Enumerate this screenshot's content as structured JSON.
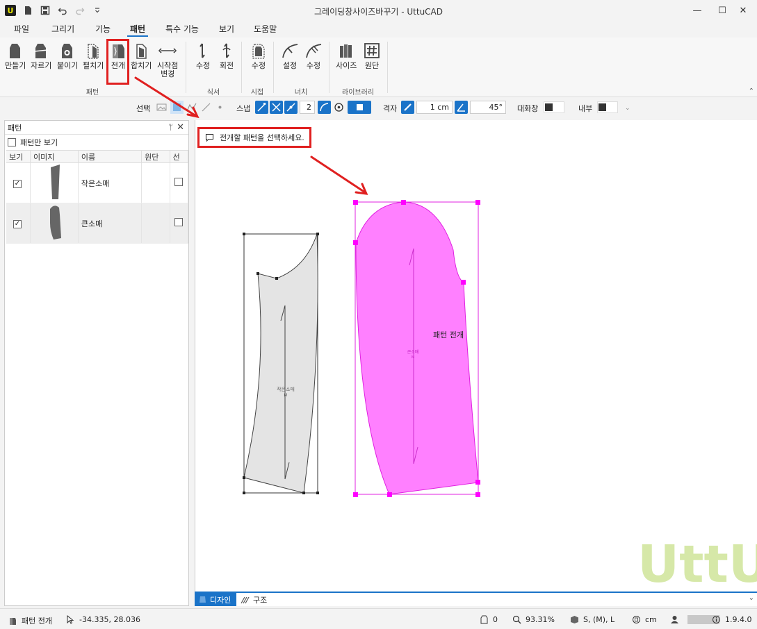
{
  "window": {
    "title": "그레이딩창사이즈바꾸기 - UttuCAD",
    "logo": "U",
    "minimize": "—",
    "maximize": "☐",
    "close": "✕"
  },
  "menu": {
    "tabs": [
      {
        "label": "파일"
      },
      {
        "label": "그리기"
      },
      {
        "label": "기능"
      },
      {
        "label": "패턴"
      },
      {
        "label": "특수 기능"
      },
      {
        "label": "보기"
      },
      {
        "label": "도움말"
      }
    ]
  },
  "ribbon": {
    "buttons": [
      {
        "label": "만들기"
      },
      {
        "label": "자르기"
      },
      {
        "label": "붙이기"
      },
      {
        "label": "펼치기"
      },
      {
        "label": "전개"
      },
      {
        "label": "합치기"
      },
      {
        "label": "시작점\n변경"
      },
      {
        "label": "수정"
      },
      {
        "label": "회전"
      },
      {
        "label": "수정"
      },
      {
        "label": "설정"
      },
      {
        "label": "수정"
      },
      {
        "label": "사이즈"
      },
      {
        "label": "원단"
      }
    ],
    "groups": [
      {
        "label": "패턴"
      },
      {
        "label": "식서"
      },
      {
        "label": "시접"
      },
      {
        "label": "너치"
      },
      {
        "label": "라이브러리"
      }
    ]
  },
  "toolbar2": {
    "select_label": "선택",
    "snap_label": "스냅",
    "snap_value": "2",
    "grid_label": "격자",
    "grid_value": "1 cm",
    "angle_value": "45°",
    "dialog_label": "대화창",
    "inner_label": "내부"
  },
  "panel": {
    "title": "패턴",
    "pin": "ᛘ",
    "close": "✕",
    "pattern_only_label": "패턴만 보기",
    "columns": [
      "보기",
      "이미지",
      "이름",
      "원단",
      "선"
    ],
    "rows": [
      {
        "visible": "✓",
        "name": "작은소매",
        "fabric": "",
        "line": ""
      },
      {
        "visible": "✓",
        "name": "큰소매",
        "fabric": "",
        "line": ""
      }
    ]
  },
  "canvas": {
    "prompt": "전개할 패턴을 선택하세요.",
    "pattern1_label": "작은소매",
    "pattern1_size": "M",
    "pattern2_label": "큰소매",
    "pattern2_size": "M",
    "annotation": "패턴 전개",
    "watermark": "UttU",
    "colors": {
      "selected_fill": "#ff80ff",
      "selected_stroke": "#e020e0",
      "annotation_red": "#e02020",
      "gray_fill": "#e4e4e4"
    }
  },
  "bottom_tabs": {
    "design": "디자인",
    "structure": "구조"
  },
  "status": {
    "mode": "패턴 전개",
    "coords": "-34.335, 28.036",
    "count": "0",
    "zoom": "93.31%",
    "size": "S, (M), L",
    "unit": "cm",
    "version": "1.9.4.0"
  }
}
